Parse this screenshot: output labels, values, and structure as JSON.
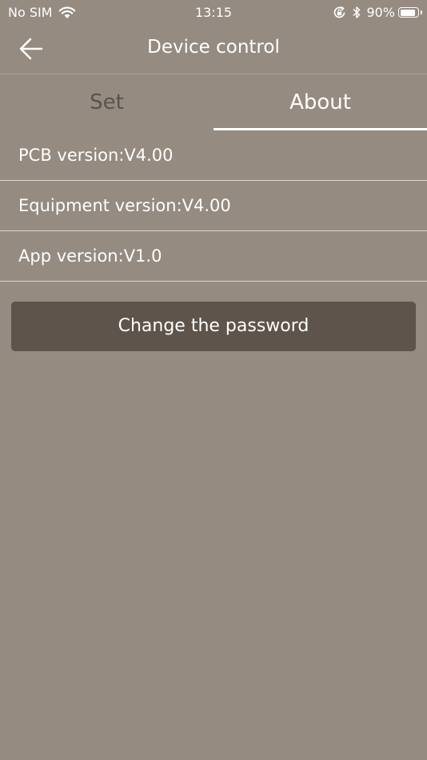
{
  "status_bar": {
    "carrier": "No SIM",
    "time": "13:15",
    "battery_percent": "90%",
    "battery_level": 0.9
  },
  "nav": {
    "title": "Device control"
  },
  "tabs": [
    {
      "label": "Set",
      "selected": false
    },
    {
      "label": "About",
      "selected": true
    }
  ],
  "info": [
    {
      "text": "PCB version:V4.00"
    },
    {
      "text": "Equipment version:V4.00"
    },
    {
      "text": "App version:V1.0"
    }
  ],
  "actions": {
    "change_password_label": "Change the password"
  },
  "colors": {
    "background": "#958b80",
    "button": "#5e544b",
    "inactive_tab": "#5a534c",
    "text": "#ffffff"
  }
}
